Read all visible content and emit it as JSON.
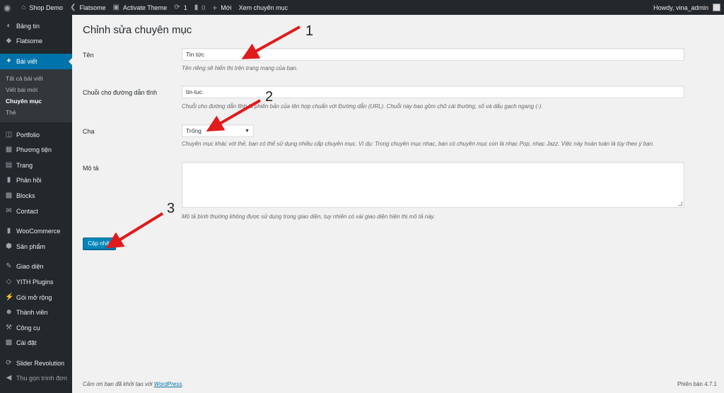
{
  "adminbar": {
    "site_name": "Shop Demo",
    "theme_name": "Flatsome",
    "activate_theme": "Activate Theme",
    "updates_count": "1",
    "comments_count": "0",
    "new_label": "Mới",
    "view_category": "Xem chuyên mục",
    "howdy": "Howdy, vina_admin"
  },
  "sidebar": {
    "items_top": [
      {
        "label": "Bảng tin",
        "icon": "dashboard-icon"
      },
      {
        "label": "Flatsome",
        "icon": "flatsome-icon"
      }
    ],
    "current": {
      "label": "Bài viết",
      "icon": "pin-icon"
    },
    "submenu": [
      "Tất cả bài viết",
      "Viết bài mới",
      "Chuyên mục",
      "Thẻ"
    ],
    "submenu_active_index": 2,
    "items_group1": [
      {
        "label": "Portfolio",
        "icon": "portfolio-icon"
      },
      {
        "label": "Phương tiện",
        "icon": "media-icon"
      },
      {
        "label": "Trang",
        "icon": "page-icon"
      },
      {
        "label": "Phản hồi",
        "icon": "comments-icon"
      },
      {
        "label": "Blocks",
        "icon": "blocks-icon"
      },
      {
        "label": "Contact",
        "icon": "mail-icon"
      }
    ],
    "items_group2": [
      {
        "label": "WooCommerce",
        "icon": "woocommerce-icon"
      },
      {
        "label": "Sản phẩm",
        "icon": "product-icon"
      }
    ],
    "items_group3": [
      {
        "label": "Giao diện",
        "icon": "appearance-icon"
      },
      {
        "label": "YITH Plugins",
        "icon": "yith-icon"
      },
      {
        "label": "Gói mở rộng",
        "icon": "plugins-icon"
      },
      {
        "label": "Thành viên",
        "icon": "users-icon"
      },
      {
        "label": "Công cụ",
        "icon": "tools-icon"
      },
      {
        "label": "Cài đặt",
        "icon": "settings-icon"
      }
    ],
    "items_group4": [
      {
        "label": "Slider Revolution",
        "icon": "slider-icon"
      },
      {
        "label": "Thu gọn trình đơn",
        "icon": "collapse-icon"
      }
    ]
  },
  "form": {
    "title": "Chỉnh sửa chuyên mục",
    "name_label": "Tên",
    "name_value": "Tin tức",
    "name_desc": "Tên riêng sẽ hiển thị trên trang mạng của bạn.",
    "slug_label": "Chuỗi cho đường dẫn tĩnh",
    "slug_value": "tin-tuc",
    "slug_desc": "Chuỗi cho đường dẫn tĩnh là phiên bản của tên hợp chuẩn với Đường dẫn (URL). Chuỗi này bao gồm chữ cái thường, số và dấu gạch ngang (-).",
    "parent_label": "Cha",
    "parent_value": "Trống",
    "parent_desc": "Chuyên mục khác với thẻ, bạn có thể sử dụng nhiều cấp chuyên mục. Ví dụ: Trong chuyên mục nhạc, bạn có chuyên mục con là nhạc Pop, nhạc Jazz. Việc này hoàn toàn là tùy theo ý bạn.",
    "desc_label": "Mô tả",
    "desc_value": "",
    "desc_desc": "Mô tả bình thường không được sử dụng trong giao diện, tuy nhiên có vài giao diện hiện thị mô tả này.",
    "submit_label": "Cập nhật"
  },
  "footer": {
    "thanks_prefix": "Cảm ơn bạn đã khởi tạo với ",
    "wordpress_link": "WordPress",
    "thanks_suffix": ".",
    "version": "Phiên bản 4.7.1"
  },
  "annotations": [
    "1",
    "2",
    "3"
  ],
  "colors": {
    "adminbar_bg": "#23282d",
    "sidebar_bg": "#23282d",
    "submenu_bg": "#32373c",
    "current_bg": "#0073aa",
    "button_bg": "#0085ba",
    "arrow_red": "#e01b1b",
    "page_bg": "#f1f1f1"
  }
}
